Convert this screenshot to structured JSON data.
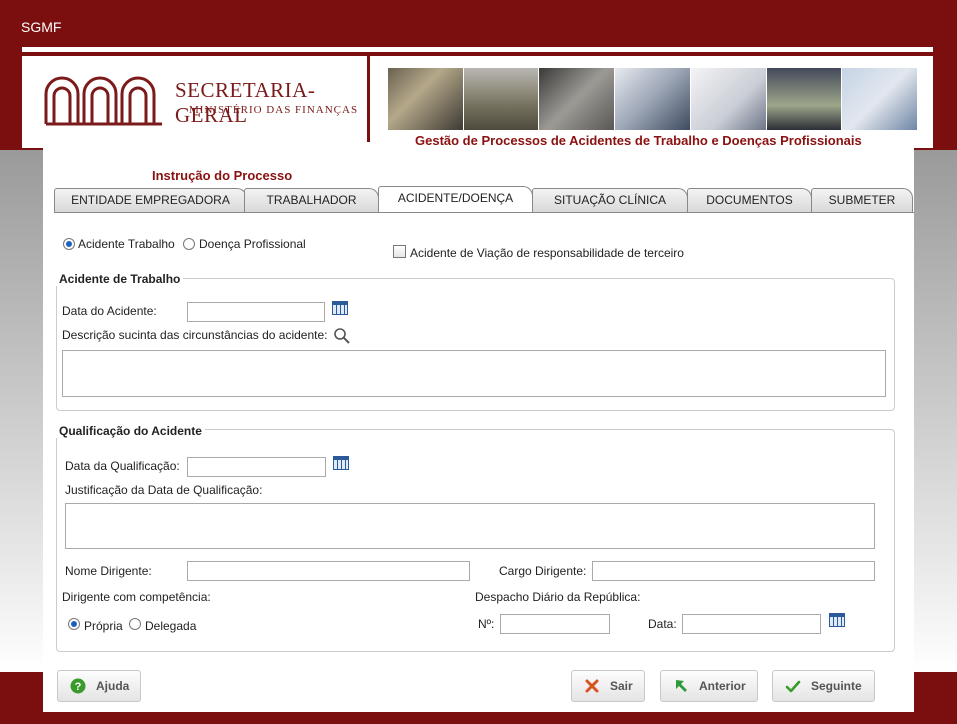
{
  "app": {
    "title": "SGMF"
  },
  "header": {
    "logo_name": "SECRETARIA-GERAL",
    "logo_sub": "MINISTÉRIO DAS FINANÇAS",
    "tagline": "Gestão de Processos de Acidentes de Trabalho e Doenças Profissionais",
    "brand_color": "#7b0f0f"
  },
  "process": {
    "heading": "Instrução do Processo",
    "tabs": [
      {
        "label": "ENTIDADE EMPREGADORA",
        "active": false
      },
      {
        "label": "TRABALHADOR",
        "active": false
      },
      {
        "label": "ACIDENTE/DOENÇA",
        "active": true
      },
      {
        "label": "SITUAÇÃO CLÍNICA",
        "active": false
      },
      {
        "label": "DOCUMENTOS",
        "active": false
      },
      {
        "label": "SUBMETER",
        "active": false
      }
    ]
  },
  "type_selector": {
    "accident_label": "Acidente Trabalho",
    "accident_selected": true,
    "disease_label": "Doença Profissional",
    "disease_selected": false,
    "road_checkbox_label": "Acidente de Viação de responsabilidade de terceiro",
    "road_checkbox_checked": false
  },
  "accident": {
    "legend": "Acidente de Trabalho",
    "date_label": "Data do Acidente:",
    "date_value": "",
    "description_label": "Descrição sucinta das circunstâncias do acidente:",
    "description_value": ""
  },
  "qualification": {
    "legend": "Qualificação do Acidente",
    "date_label": "Data da Qualificação:",
    "date_value": "",
    "justification_label": "Justificação da Data de Qualificação:",
    "justification_value": "",
    "manager_name_label": "Nome Dirigente:",
    "manager_name_value": "",
    "manager_role_label": "Cargo Dirigente:",
    "manager_role_value": "",
    "competence_label": "Dirigente com competência:",
    "own_label": "Própria",
    "own_selected": true,
    "delegated_label": "Delegada",
    "delegated_selected": false,
    "dispatch_label": "Despacho Diário da República:",
    "number_label": "Nº:",
    "number_value": "",
    "dispatch_date_label": "Data:",
    "dispatch_date_value": ""
  },
  "buttons": {
    "help": "Ajuda",
    "exit": "Sair",
    "previous": "Anterior",
    "next": "Seguinte"
  },
  "icons": [
    "calendar-icon",
    "search-icon",
    "help-icon",
    "close-icon",
    "back-arrow-icon",
    "check-icon"
  ]
}
